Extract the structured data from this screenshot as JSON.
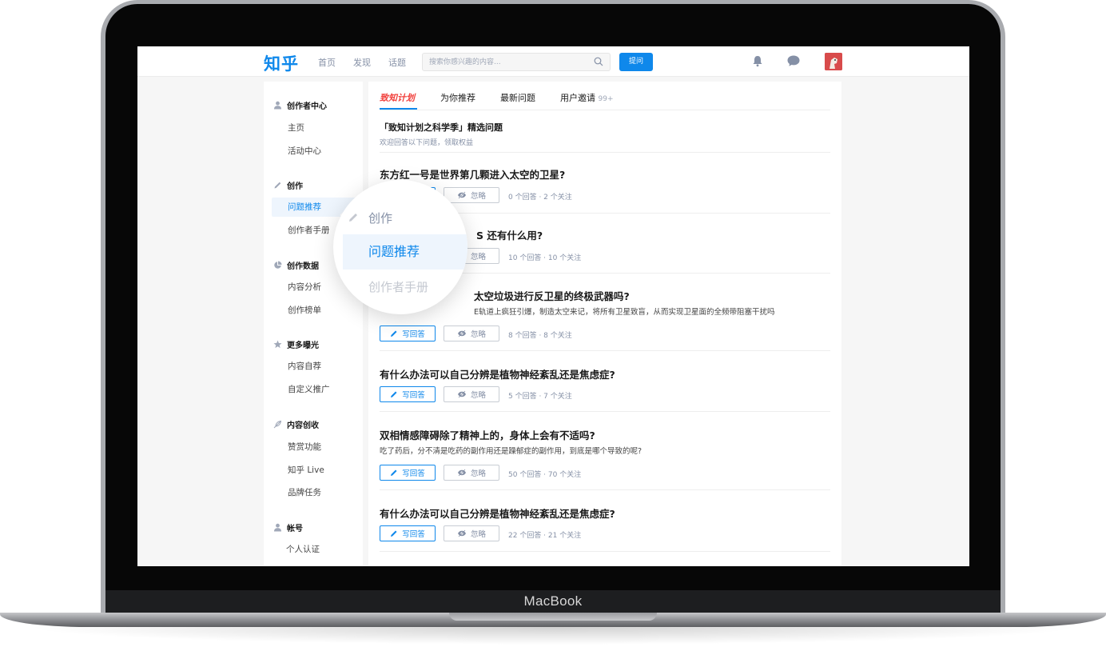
{
  "device": {
    "label": "MacBook"
  },
  "topbar": {
    "logo": "知乎",
    "nav": [
      "首页",
      "发现",
      "话题"
    ],
    "search_placeholder": "搜索你感兴趣的内容...",
    "ask_label": "提问"
  },
  "sidebar": {
    "creator_center": {
      "title": "创作者中心",
      "items": [
        "主页",
        "活动中心"
      ]
    },
    "create": {
      "title": "创作",
      "items": [
        "问题推荐",
        "创作者手册"
      ],
      "active": "问题推荐"
    },
    "data": {
      "title": "创作数据",
      "items": [
        "内容分析",
        "创作榜单"
      ]
    },
    "exposure": {
      "title": "更多曝光",
      "items": [
        "内容自荐",
        "自定义推广"
      ]
    },
    "revenue": {
      "title": "内容创收",
      "items": [
        "赞赏功能",
        "知乎 Live",
        "品牌任务"
      ]
    },
    "account": {
      "title": "帐号",
      "items": [
        "个人认证"
      ]
    }
  },
  "tabs": {
    "brand": "致知计划",
    "recommend": "为你推荐",
    "latest": "最新问题",
    "invite": "用户邀请",
    "invite_count": "99+"
  },
  "intro": {
    "title": "「致知计划之科学季」精选问题",
    "subtitle": "欢迎回答以下问题，领取权益"
  },
  "actions": {
    "answer": "写回答",
    "ignore": "忽略"
  },
  "questions": [
    {
      "title": "东方红一号是世界第几颗进入太空的卫星?",
      "meta": "0 个回答 · 2 个关注"
    },
    {
      "title": "S 还有什么用?",
      "meta": "10 个回答 · 10 个关注"
    },
    {
      "title": "太空垃圾进行反卫星的终极武器吗?",
      "desc": "E轨道上疯狂引爆，制造太空来记，将所有卫星致盲，从而实现卫星面的全频带阻塞干扰吗",
      "meta": "8 个回答 · 8 个关注"
    },
    {
      "title": "有什么办法可以自己分辨是植物神经紊乱还是焦虑症?",
      "meta": "5 个回答 · 7 个关注"
    },
    {
      "title": "双相情感障碍除了精神上的，身体上会有不适吗?",
      "desc": "吃了药后，分不清是吃药的副作用还是躁郁症的副作用，到底是哪个导致的呢?",
      "meta": "50 个回答 · 70 个关注"
    },
    {
      "title": "有什么办法可以自己分辨是植物神经紊乱还是焦虑症?",
      "meta": "22 个回答 · 21 个关注"
    }
  ],
  "magnifier": {
    "head": "创作",
    "active": "问题推荐",
    "next": "创作者手册"
  },
  "colors": {
    "brand_blue": "#0f88eb",
    "brand_red": "#f1403c"
  }
}
